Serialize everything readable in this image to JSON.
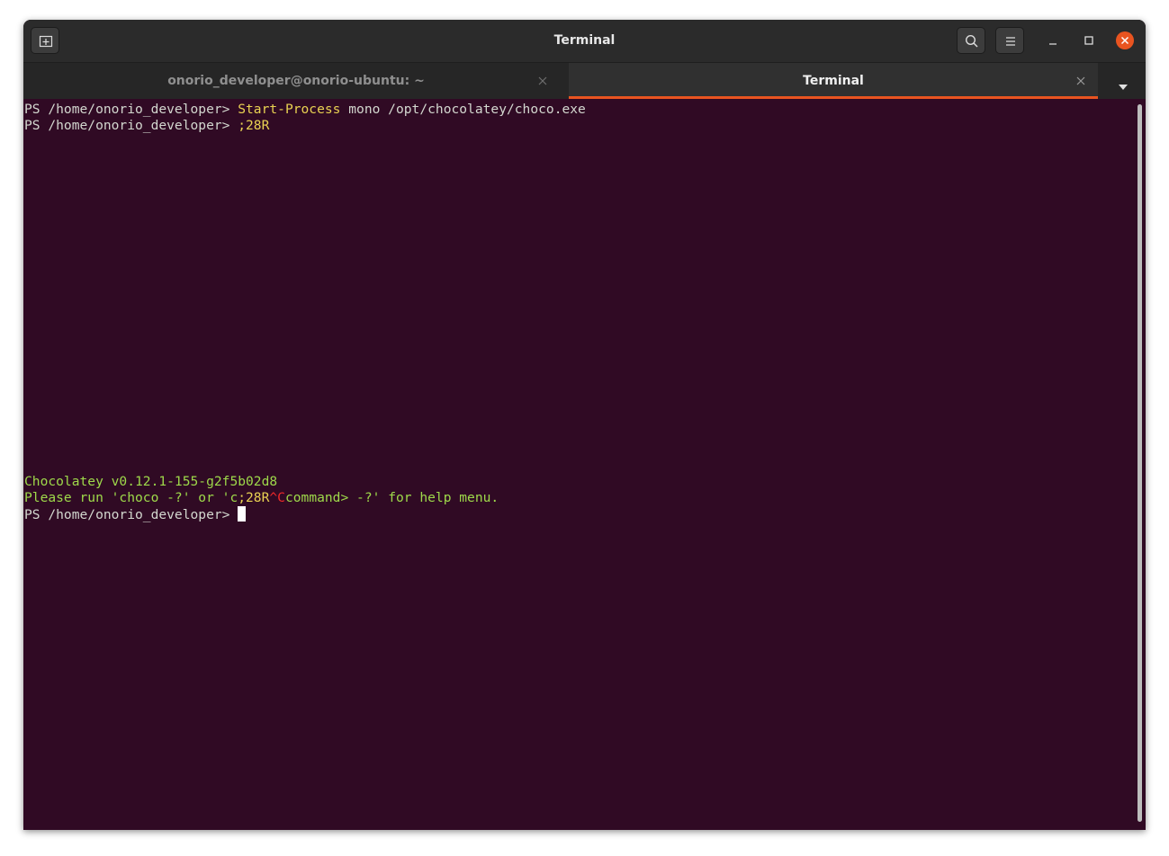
{
  "window": {
    "title": "Terminal"
  },
  "tabs": [
    {
      "label": "onorio_developer@onorio-ubuntu: ~",
      "active": false
    },
    {
      "label": "Terminal",
      "active": true
    }
  ],
  "terminal": {
    "lines": [
      {
        "prompt": "PS /home/onorio_developer> ",
        "command": "Start-Process",
        "args": " mono /opt/chocolatey/choco.exe"
      },
      {
        "prompt": "PS /home/onorio_developer> ",
        "command": ";28R"
      },
      {
        "output": "Chocolatey v0.12.1-155-g2f5b02d8"
      },
      {
        "output_a": "Please run 'choco -?' or 'c",
        "output_b": ";28R",
        "output_c": "^C",
        "output_d": "command> -?' for help menu."
      },
      {
        "prompt": "PS /home/onorio_developer> "
      }
    ]
  },
  "colors": {
    "terminal_bg": "#300a24",
    "accent": "#e95420"
  },
  "icons": {
    "new_tab": "new-tab-icon",
    "search": "search-icon",
    "menu": "hamburger-menu-icon",
    "minimize": "minimize-icon",
    "maximize": "maximize-icon",
    "close": "close-icon"
  }
}
